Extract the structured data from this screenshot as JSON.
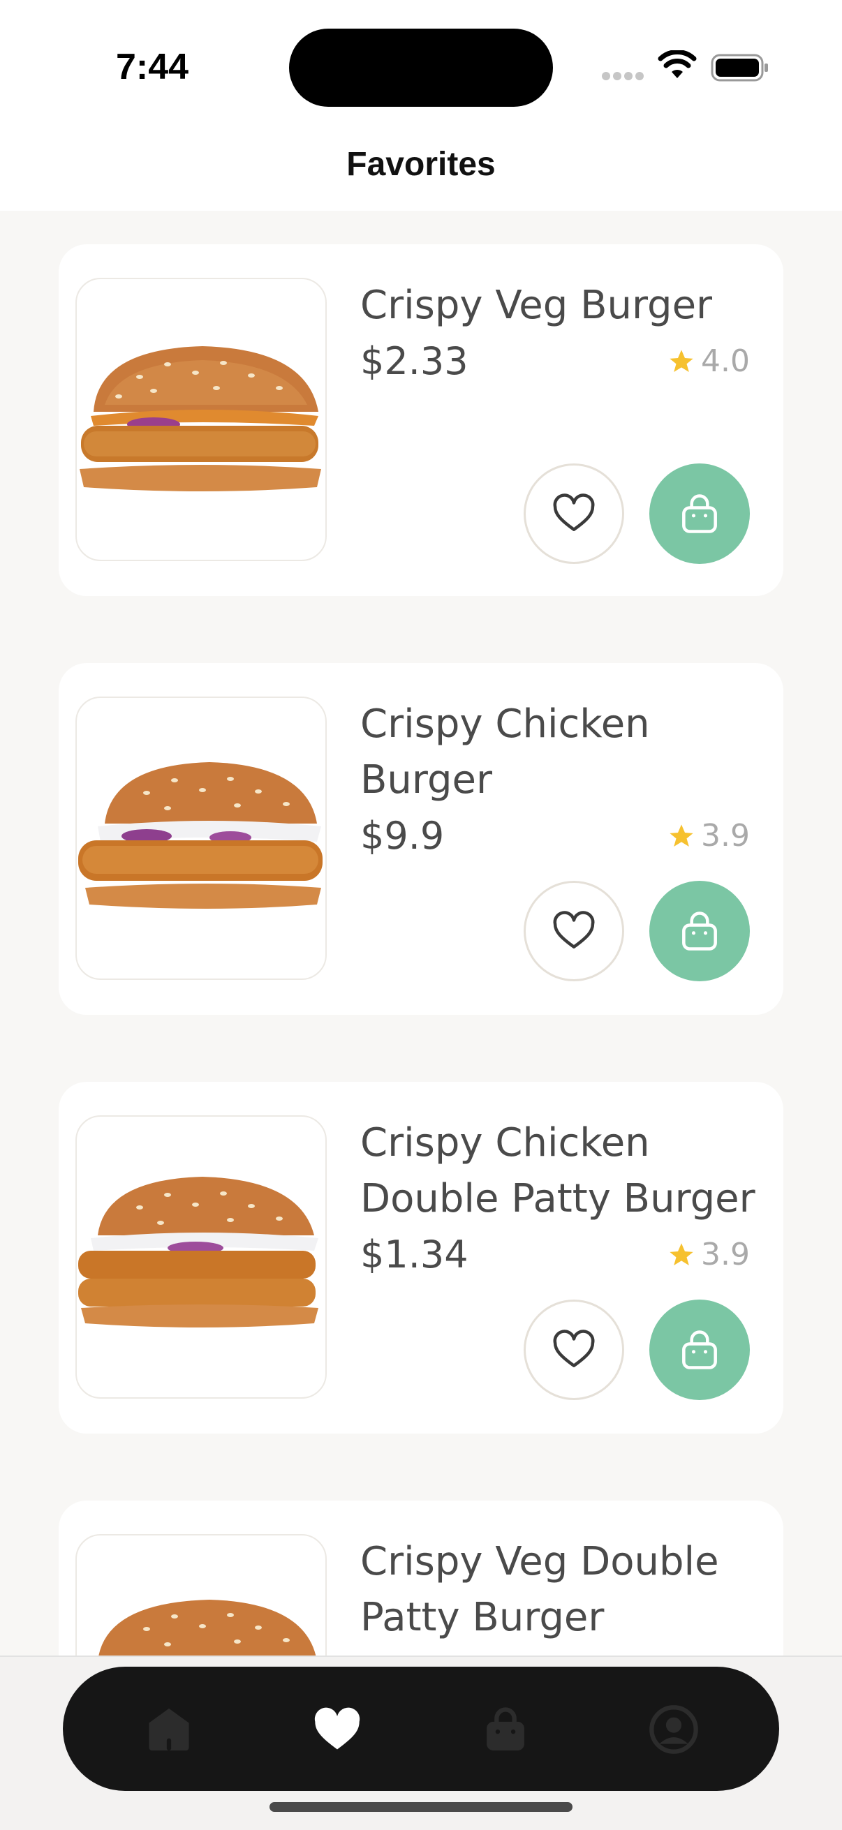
{
  "status_bar": {
    "time": "7:44"
  },
  "header": {
    "title": "Favorites"
  },
  "items": [
    {
      "name": "Crispy Veg Burger",
      "price": "$2.33",
      "rating": "4.0",
      "image_icon": "veg-burger-image"
    },
    {
      "name": "Crispy Chicken Burger",
      "price": "$9.9",
      "rating": "3.9",
      "image_icon": "chicken-burger-image"
    },
    {
      "name": "Crispy Chicken Double Patty Burger",
      "price": "$1.34",
      "rating": "3.9",
      "image_icon": "chicken-double-burger-image"
    },
    {
      "name": "Crispy Veg Double Patty Burger",
      "price": "",
      "rating": "",
      "image_icon": "veg-double-burger-image"
    }
  ],
  "tab_bar": {
    "tabs": [
      {
        "icon": "home-icon",
        "active": false
      },
      {
        "icon": "heart-icon",
        "active": true
      },
      {
        "icon": "bag-icon",
        "active": false
      },
      {
        "icon": "profile-icon",
        "active": false
      }
    ]
  },
  "colors": {
    "accent_green": "#7bc6a4",
    "star": "#f6c12f",
    "tab_bar": "#161616",
    "background": "#f8f7f5"
  }
}
